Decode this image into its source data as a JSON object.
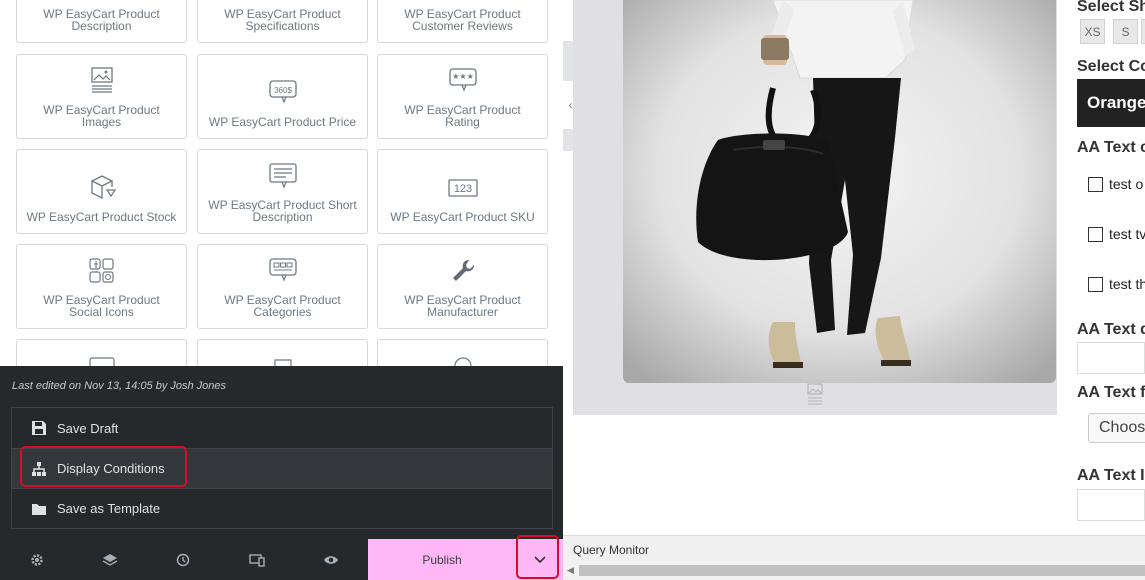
{
  "widgets": [
    {
      "label": "WP EasyCart Product Description",
      "icon": "description-icon"
    },
    {
      "label": "WP EasyCart Product Specifications",
      "icon": "specifications-icon"
    },
    {
      "label": "WP EasyCart Product Customer Reviews",
      "icon": "reviews-icon"
    },
    {
      "label": "WP EasyCart Product Images",
      "icon": "images-icon"
    },
    {
      "label": "WP EasyCart Product Price",
      "icon": "price-icon",
      "icon_text": "360$"
    },
    {
      "label": "WP EasyCart Product Rating",
      "icon": "rating-icon"
    },
    {
      "label": "WP EasyCart Product Stock",
      "icon": "stock-icon"
    },
    {
      "label": "WP EasyCart Product Short Description",
      "icon": "short-description-icon"
    },
    {
      "label": "WP EasyCart Product SKU",
      "icon": "sku-icon",
      "icon_text": "123"
    },
    {
      "label": "WP EasyCart Product Social Icons",
      "icon": "social-icons-icon"
    },
    {
      "label": "WP EasyCart Product Categories",
      "icon": "categories-icon"
    },
    {
      "label": "WP EasyCart Product Manufacturer",
      "icon": "wrench-icon"
    }
  ],
  "popup": {
    "last_edited": "Last edited on Nov 13, 14:05 by Josh Jones",
    "items": [
      {
        "label": "Save Draft",
        "icon": "save-icon"
      },
      {
        "label": "Display Conditions",
        "icon": "sitemap-icon",
        "highlighted": true
      },
      {
        "label": "Save as Template",
        "icon": "folder-icon"
      }
    ]
  },
  "footer": {
    "buttons": [
      "settings-icon",
      "layers-icon",
      "history-icon",
      "responsive-icon",
      "preview-icon"
    ],
    "publish_label": "Publish",
    "publish_color": "#ffb8f5",
    "dropdown_icon": "chevron-down-icon"
  },
  "preview": {
    "options": {
      "select_size": "Select Sh",
      "sizes": [
        "XS",
        "S"
      ],
      "select_color": "Select Co",
      "color_value": "Orange",
      "text_c": "AA Text c",
      "checkboxes": [
        "test o",
        "test tv",
        "test th"
      ],
      "text_d": "AA Text d",
      "text_f": "AA Text fi",
      "select_placeholder": "Choos",
      "text_i": "AA Text Ir"
    },
    "query_monitor": "Query Monitor"
  },
  "colors": {
    "panel_dark": "#26292c",
    "highlight": "#d60d2a",
    "publish": "#ffb8f5"
  }
}
